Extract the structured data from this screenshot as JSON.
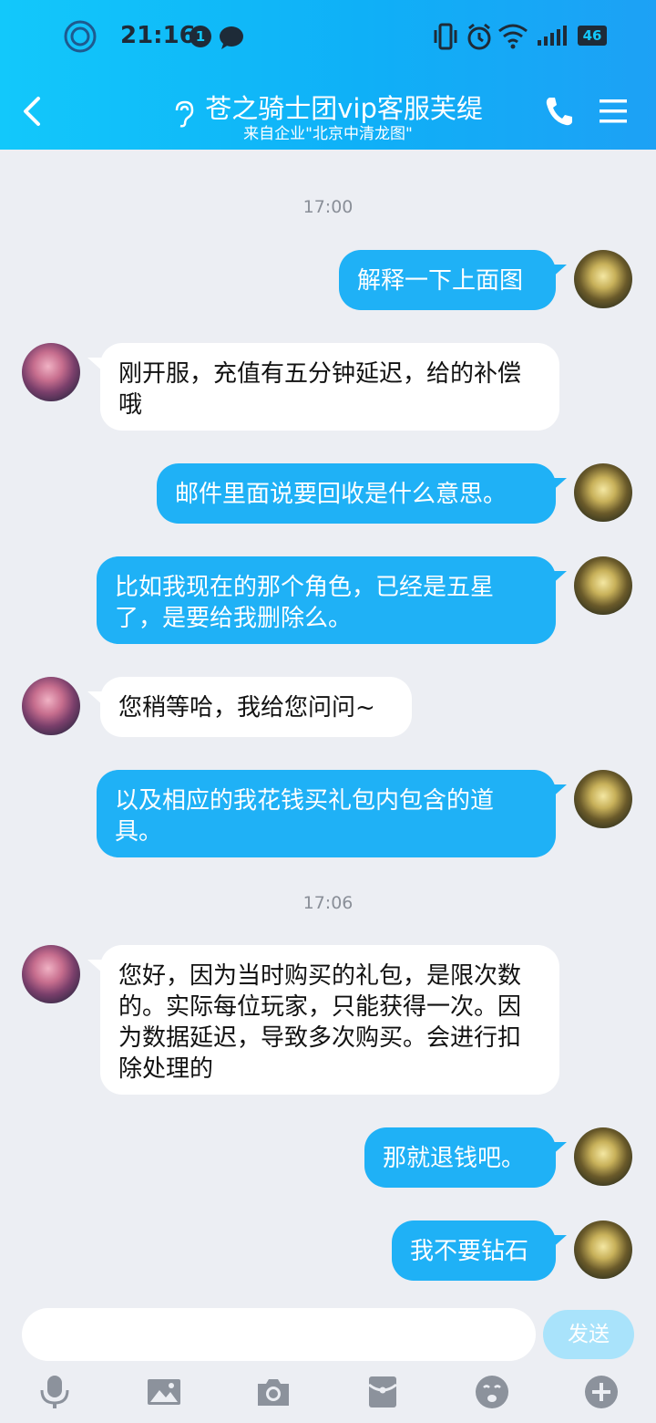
{
  "status_bar": {
    "time": "21:16",
    "notification_count": "1",
    "battery": "46"
  },
  "header": {
    "title": "苍之骑士团vip客服芙缇",
    "subtitle": "来自企业\"北京中清龙图\""
  },
  "messages": [
    {
      "type": "time",
      "text": "17:00"
    },
    {
      "type": "out",
      "text": "解释一下上面图"
    },
    {
      "type": "in",
      "text": "刚开服，充值有五分钟延迟，给的补偿哦"
    },
    {
      "type": "out",
      "text": "邮件里面说要回收是什么意思。"
    },
    {
      "type": "out",
      "text": "比如我现在的那个角色，已经是五星了，是要给我删除么。"
    },
    {
      "type": "in",
      "text": "您稍等哈，我给您问问~"
    },
    {
      "type": "out",
      "text": "以及相应的我花钱买礼包内包含的道具。"
    },
    {
      "type": "time",
      "text": "17:06"
    },
    {
      "type": "in",
      "text": "您好，因为当时购买的礼包，是限次数的。实际每位玩家，只能获得一次。因为数据延迟，导致多次购买。会进行扣除处理的"
    },
    {
      "type": "out",
      "text": "那就退钱吧。"
    },
    {
      "type": "out",
      "text": "我不要钻石"
    }
  ],
  "input": {
    "value": "",
    "placeholder": "",
    "send_label": "发送"
  },
  "toolbar": {
    "icons": [
      "microphone-icon",
      "image-icon",
      "camera-icon",
      "red-packet-icon",
      "emoji-icon",
      "plus-icon"
    ]
  },
  "colors": {
    "accent": "#1fb1f6",
    "header_start": "#12c8fb",
    "header_end": "#1da1f5",
    "background": "#eceef3"
  }
}
